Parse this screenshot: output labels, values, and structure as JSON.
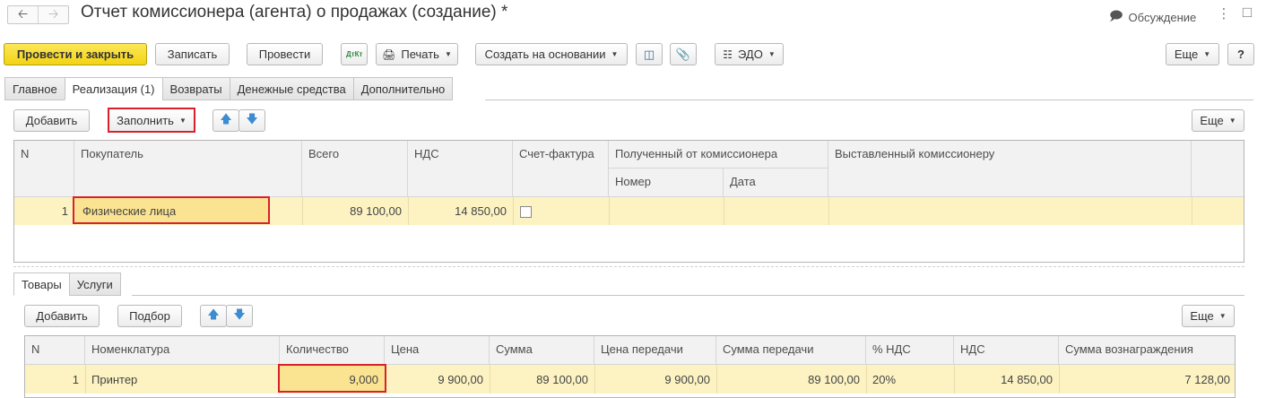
{
  "window": {
    "title": "Отчет комиссионера (агента) о продажах (создание) *",
    "discussion_label": "Обсуждение"
  },
  "toolbar": {
    "post_close": "Провести и закрыть",
    "save": "Записать",
    "post": "Провести",
    "dt_kt": "ДтКт",
    "print": "Печать",
    "create_based": "Создать на основании",
    "edo": "ЭДО",
    "more": "Еще",
    "help": "?"
  },
  "tabs": [
    "Главное",
    "Реализация (1)",
    "Возвраты",
    "Денежные средства",
    "Дополнительно"
  ],
  "sales": {
    "add": "Добавить",
    "fill": "Заполнить",
    "more": "Еще",
    "headers": {
      "n": "N",
      "buyer": "Покупатель",
      "total": "Всего",
      "vat": "НДС",
      "invoice": "Счет-фактура",
      "received": "Полученный от комиссионера",
      "number": "Номер",
      "date": "Дата",
      "issued": "Выставленный комиссионеру"
    },
    "rows": [
      {
        "n": "1",
        "buyer": "Физические лица",
        "total": "89 100,00",
        "vat": "14 850,00",
        "number": "",
        "date": ""
      }
    ]
  },
  "subtabs": [
    "Товары",
    "Услуги"
  ],
  "goods": {
    "add": "Добавить",
    "select": "Подбор",
    "more": "Еще",
    "headers": {
      "n": "N",
      "item": "Номенклатура",
      "qty": "Количество",
      "price": "Цена",
      "sum": "Сумма",
      "transfer_price": "Цена передачи",
      "transfer_sum": "Сумма передачи",
      "vat_rate": "% НДС",
      "vat": "НДС",
      "reward": "Сумма вознаграждения"
    },
    "rows": [
      {
        "n": "1",
        "item": "Принтер",
        "qty": "9,000",
        "price": "9 900,00",
        "sum": "89 100,00",
        "transfer_price": "9 900,00",
        "transfer_sum": "89 100,00",
        "vat_rate": "20%",
        "vat": "14 850,00",
        "reward": "7 128,00"
      }
    ]
  }
}
